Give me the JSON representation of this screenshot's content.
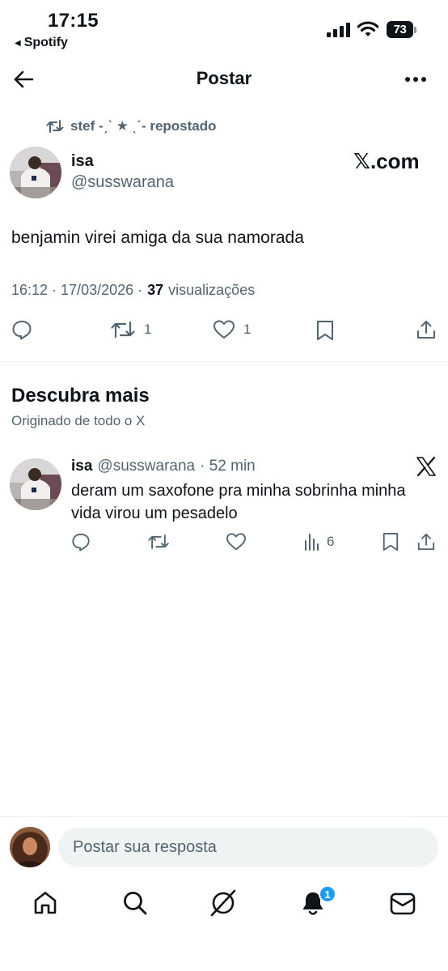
{
  "status_bar": {
    "time": "17:15",
    "back_app": "Spotify",
    "battery": "73"
  },
  "header": {
    "title": "Postar"
  },
  "post": {
    "repost_by": "stef -ˏˋ ★ ˎˊ- repostado",
    "name": "isa",
    "handle": "@susswarana",
    "badge_label": "𝕏.com",
    "text": "benjamin virei amiga da sua namorada",
    "timestamp": "16:12 · 17/03/2026 ·",
    "views_count": "37",
    "views_label": "visualizações",
    "actions": {
      "retweets": "1",
      "likes": "1"
    }
  },
  "discover": {
    "title": "Descubra mais",
    "subtitle": "Originado de todo o X",
    "tweet": {
      "name": "isa",
      "handle": "@susswarana",
      "time": "· 52 min",
      "text": "deram um saxofone pra minha sobrinha minha vida virou um pesadelo",
      "views": "6"
    }
  },
  "reply": {
    "placeholder": "Postar sua resposta"
  },
  "bottom_nav": {
    "notifications_badge": "1"
  },
  "colors": {
    "accent": "#1d9bf0",
    "text": "#0f1419",
    "secondary": "#536471"
  }
}
